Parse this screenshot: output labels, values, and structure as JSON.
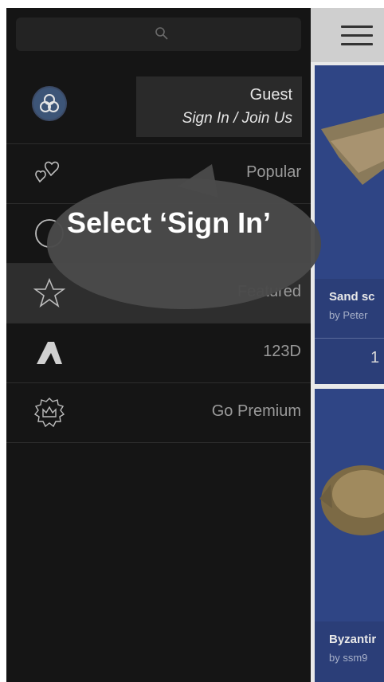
{
  "search": {
    "icon": "search-icon"
  },
  "profile": {
    "name": "Guest",
    "signin_label": "Sign In / Join Us",
    "avatar_icon": "trefoil-logo-icon"
  },
  "menu": [
    {
      "label": "Popular",
      "icon": "hearts-icon"
    },
    {
      "label": "",
      "icon": "circle-icon"
    },
    {
      "label": "Featured",
      "icon": "star-icon"
    },
    {
      "label": "123D",
      "icon": "autodesk-logo-icon"
    },
    {
      "label": "Go Premium",
      "icon": "crown-badge-icon"
    }
  ],
  "tooltip": {
    "text": "Select ‘Sign In’"
  },
  "content": {
    "cards": [
      {
        "title": "Sand sc",
        "author": "by Peter",
        "count": "1"
      },
      {
        "title": "Byzantir",
        "author": "by ssm9"
      }
    ]
  },
  "colors": {
    "drawer_bg": "#151515",
    "card_blue": "#2f4585",
    "bubble": "#4a4a4a"
  }
}
